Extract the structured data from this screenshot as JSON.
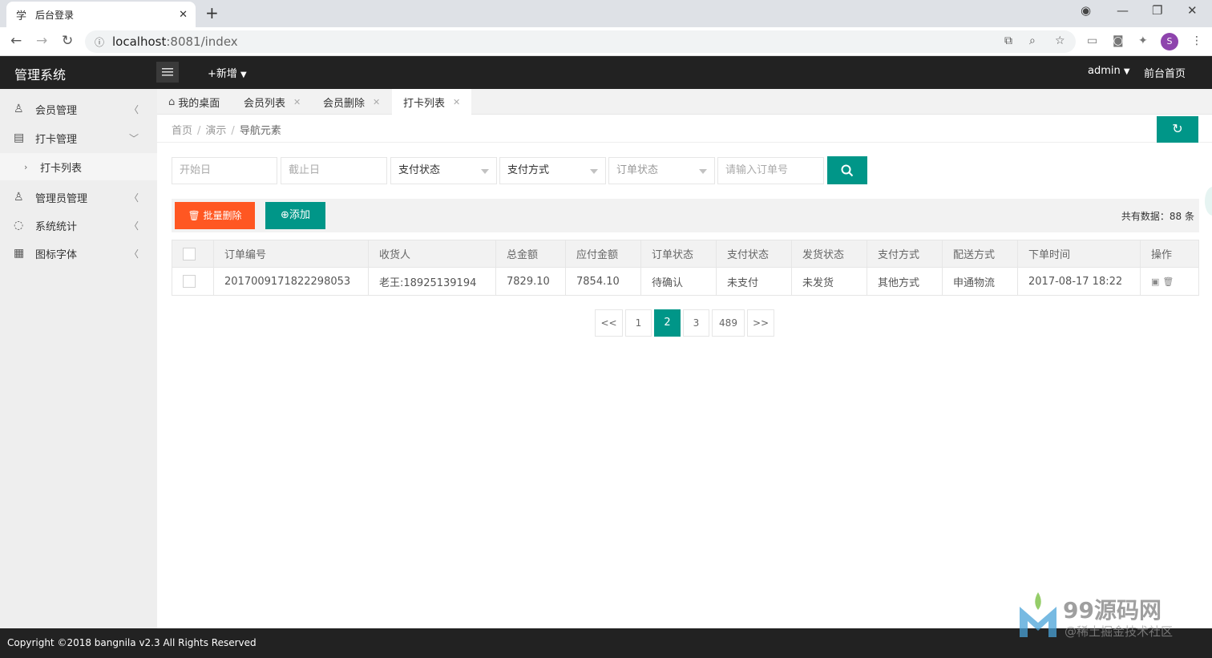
{
  "browser": {
    "tab_title": "后台登录",
    "favicon": "学",
    "url_host": "localhost",
    "url_rest": ":8081/index",
    "avatar_initial": "S"
  },
  "header": {
    "logo": "管理系统",
    "add_new": "+新增",
    "admin": "admin",
    "front_home": "前台首页"
  },
  "sidebar": {
    "items": [
      {
        "label": "会员管理"
      },
      {
        "label": "打卡管理"
      },
      {
        "label": "打卡列表"
      },
      {
        "label": "管理员管理"
      },
      {
        "label": "系统统计"
      },
      {
        "label": "图标字体"
      }
    ]
  },
  "page_tabs": [
    {
      "label": "我的桌面"
    },
    {
      "label": "会员列表"
    },
    {
      "label": "会员删除"
    },
    {
      "label": "打卡列表"
    }
  ],
  "breadcrumb": {
    "home": "首页",
    "demo": "演示",
    "current": "导航元素"
  },
  "filters": {
    "start_date": "开始日",
    "end_date": "截止日",
    "pay_status": "支付状态",
    "pay_method": "支付方式",
    "order_status": "订单状态",
    "order_no": "请输入订单号"
  },
  "toolbar": {
    "batch_delete": "批量删除",
    "add": "添加",
    "total": "共有数据：88 条"
  },
  "table": {
    "headers": [
      "订单编号",
      "收货人",
      "总金额",
      "应付金额",
      "订单状态",
      "支付状态",
      "发货状态",
      "支付方式",
      "配送方式",
      "下单时间",
      "操作"
    ],
    "rows": [
      [
        "2017009171822298053",
        "老王:18925139194",
        "7829.10",
        "7854.10",
        "待确认",
        "未支付",
        "未发货",
        "其他方式",
        "申通物流",
        "2017-08-17 18:22"
      ]
    ]
  },
  "pagination": {
    "prev": "<<",
    "pages": [
      "1",
      "2",
      "3",
      "489"
    ],
    "next": ">>",
    "current": "2"
  },
  "footer": {
    "copyright": "Copyright ©2018 bangnila v2.3 All Rights Reserved"
  },
  "watermark": {
    "big": "99源码网",
    "small": "@稀土掘金技术社区"
  },
  "colors": {
    "primary": "#009688",
    "danger": "#ff5722",
    "header_bg": "#222222"
  }
}
